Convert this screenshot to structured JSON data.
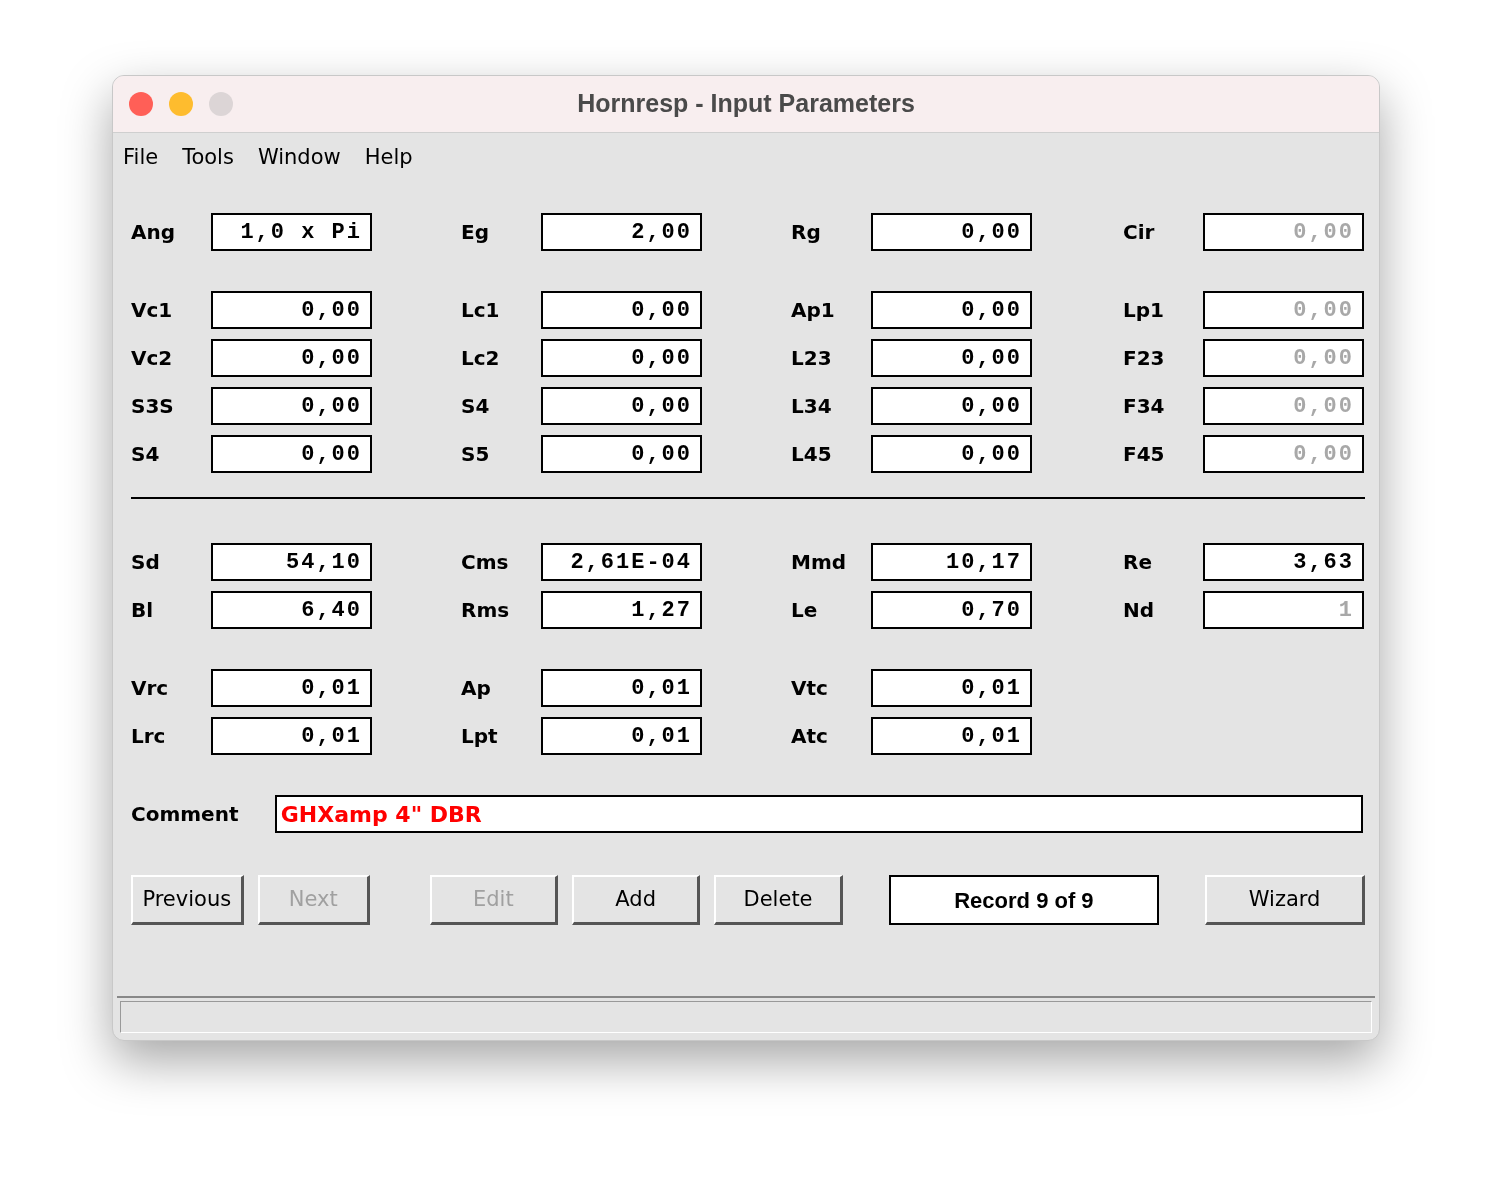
{
  "window": {
    "title": "Hornresp - Input Parameters"
  },
  "menu": [
    {
      "label": "File"
    },
    {
      "label": "Tools"
    },
    {
      "label": "Window"
    },
    {
      "label": "Help"
    }
  ],
  "groups": [
    {
      "rows": [
        [
          {
            "label": "Ang",
            "value": "1,0 x Pi",
            "disabled": false
          },
          {
            "label": "Eg",
            "value": "2,00",
            "disabled": false
          },
          {
            "label": "Rg",
            "value": "0,00",
            "disabled": false
          },
          {
            "label": "Cir",
            "value": "0,00",
            "disabled": true
          }
        ]
      ]
    },
    {
      "rows": [
        [
          {
            "label": "Vc1",
            "value": "0,00",
            "disabled": false
          },
          {
            "label": "Lc1",
            "value": "0,00",
            "disabled": false
          },
          {
            "label": "Ap1",
            "value": "0,00",
            "disabled": false
          },
          {
            "label": "Lp1",
            "value": "0,00",
            "disabled": true
          }
        ],
        [
          {
            "label": "Vc2",
            "value": "0,00",
            "disabled": false
          },
          {
            "label": "Lc2",
            "value": "0,00",
            "disabled": false
          },
          {
            "label": "L23",
            "value": "0,00",
            "disabled": false
          },
          {
            "label": "F23",
            "value": "0,00",
            "disabled": true
          }
        ],
        [
          {
            "label": "S3S",
            "value": "0,00",
            "disabled": false
          },
          {
            "label": "S4",
            "value": "0,00",
            "disabled": false
          },
          {
            "label": "L34",
            "value": "0,00",
            "disabled": false
          },
          {
            "label": "F34",
            "value": "0,00",
            "disabled": true
          }
        ],
        [
          {
            "label": "S4",
            "value": "0,00",
            "disabled": false
          },
          {
            "label": "S5",
            "value": "0,00",
            "disabled": false
          },
          {
            "label": "L45",
            "value": "0,00",
            "disabled": false
          },
          {
            "label": "F45",
            "value": "0,00",
            "disabled": true
          }
        ]
      ]
    },
    {
      "divider": true,
      "rows": [
        [
          {
            "label": "Sd",
            "value": "54,10",
            "disabled": false
          },
          {
            "label": "Cms",
            "value": "2,61E-04",
            "disabled": false
          },
          {
            "label": "Mmd",
            "value": "10,17",
            "disabled": false
          },
          {
            "label": "Re",
            "value": "3,63",
            "disabled": false
          }
        ],
        [
          {
            "label": "Bl",
            "value": "6,40",
            "disabled": false
          },
          {
            "label": "Rms",
            "value": "1,27",
            "disabled": false
          },
          {
            "label": "Le",
            "value": "0,70",
            "disabled": false
          },
          {
            "label": "Nd",
            "value": "1",
            "disabled": true
          }
        ]
      ]
    },
    {
      "rows": [
        [
          {
            "label": "Vrc",
            "value": "0,01",
            "disabled": false
          },
          {
            "label": "Ap",
            "value": "0,01",
            "disabled": false
          },
          {
            "label": "Vtc",
            "value": "0,01",
            "disabled": false
          }
        ],
        [
          {
            "label": "Lrc",
            "value": "0,01",
            "disabled": false
          },
          {
            "label": "Lpt",
            "value": "0,01",
            "disabled": false
          },
          {
            "label": "Atc",
            "value": "0,01",
            "disabled": false
          }
        ]
      ]
    }
  ],
  "comment": {
    "label": "Comment",
    "value": "GHXamp 4\" DBR"
  },
  "buttons": [
    {
      "label": "Previous",
      "disabled": false,
      "kind": "button"
    },
    {
      "label": "Next",
      "disabled": true,
      "kind": "button"
    },
    {
      "kind": "gap"
    },
    {
      "label": "Edit",
      "disabled": true,
      "kind": "wide"
    },
    {
      "label": "Add",
      "disabled": false,
      "kind": "wide"
    },
    {
      "label": "Delete",
      "disabled": false,
      "kind": "wide"
    },
    {
      "label": "Record 9 of 9",
      "kind": "record"
    },
    {
      "label": "Wizard",
      "disabled": false,
      "kind": "last"
    }
  ]
}
